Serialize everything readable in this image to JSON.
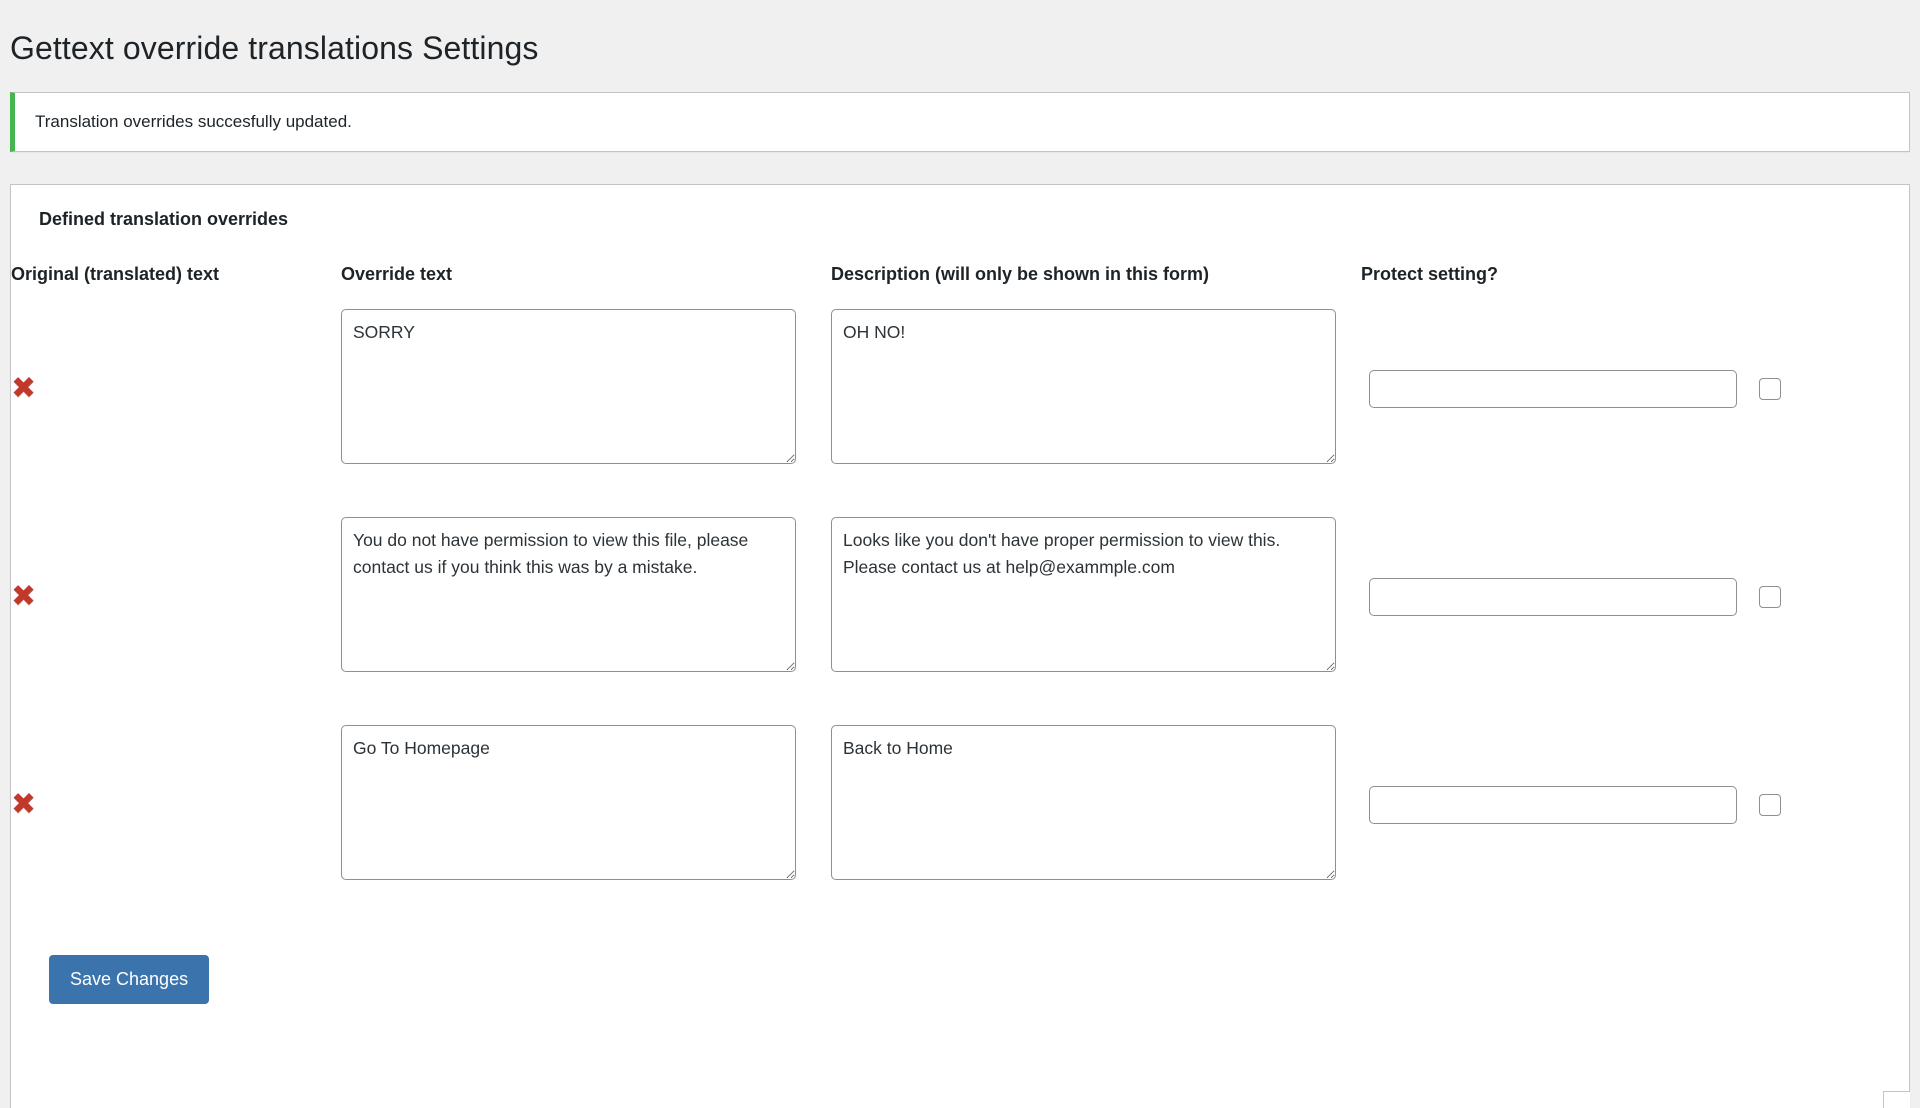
{
  "page": {
    "title": "Gettext override translations Settings"
  },
  "notice": {
    "message": "Translation overrides succesfully updated.",
    "accent_color": "#46b450"
  },
  "panel": {
    "heading": "Defined translation overrides",
    "columns": {
      "original": "Original (translated) text",
      "override": "Override text",
      "description": "Description (will only be shown in this form)",
      "protect": "Protect setting?"
    },
    "rows": [
      {
        "delete_icon": "✖",
        "override_text": "SORRY",
        "description_text": "OH NO!",
        "protect_value": "",
        "protect_checked": false
      },
      {
        "delete_icon": "✖",
        "override_text": "You do not have permission to view this file, please contact us if you think this was by a mistake.",
        "description_text": "Looks like you don't have proper permission to view this. Please contact us at help@exammple.com",
        "protect_value": "",
        "protect_checked": false
      },
      {
        "delete_icon": "✖",
        "override_text": "Go To Homepage",
        "description_text": "Back to Home",
        "protect_value": "",
        "protect_checked": false
      }
    ],
    "save_label": "Save Changes",
    "save_color": "#3b74ad",
    "delete_icon_color": "#c0392b"
  }
}
